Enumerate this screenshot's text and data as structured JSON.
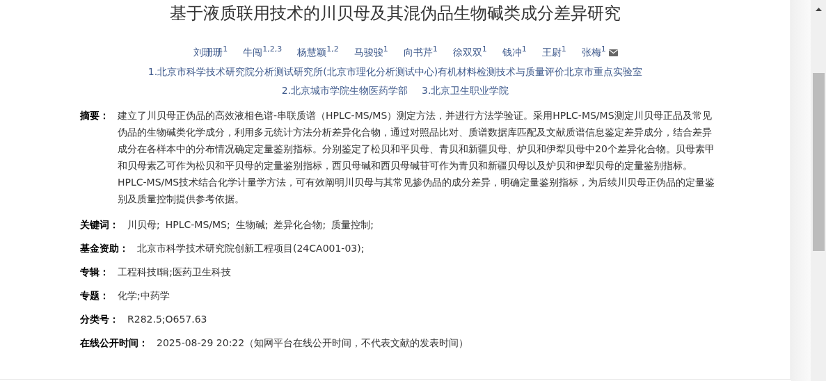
{
  "title": "基于液质联用技术的川贝母及其混伪品生物碱类成分差异研究",
  "authors": [
    {
      "name": "刘珊珊$^{1}$",
      "email": false
    },
    {
      "name": "牛闯$^{1,2,3}$",
      "email": false
    },
    {
      "name": "杨慧颖$^{1,2}$",
      "email": false
    },
    {
      "name": "马骏骏$^{1}$",
      "email": false
    },
    {
      "name": "向书芹$^{1}$",
      "email": false
    },
    {
      "name": "徐双双$^{1}$",
      "email": false
    },
    {
      "name": "钱冲$^{1}$",
      "email": false
    },
    {
      "name": "王尉$^{1}$",
      "email": false
    },
    {
      "name": "张梅$^{1}$",
      "email": true
    }
  ],
  "affiliations": [
    [
      "1.北京市科学技术研究院分析测试研究所(北京市理化分析测试中心)有机材料检测技术与质量评价北京市重点实验室"
    ],
    [
      "2.北京城市学院生物医药学部",
      "3.北京卫生职业学院"
    ]
  ],
  "abstract": {
    "label": "摘要：",
    "text": "建立了川贝母正伪品的高效液相色谱-串联质谱（HPLC-MS/MS）测定方法，并进行方法学验证。采用HPLC-MS/MS测定川贝母正品及常见伪品的生物碱类化学成分，利用多元统计方法分析差异化合物，通过对照品比对、质谱数据库匹配及文献质谱信息鉴定差异成分，结合差异成分在各样本中的分布情况确定定量鉴别指标。分别鉴定了松贝和平贝母、青贝和新疆贝母、炉贝和伊犁贝母中20个差异化合物。贝母素甲和贝母素乙可作为松贝和平贝母的定量鉴别指标，西贝母碱和西贝母碱苷可作为青贝和新疆贝母以及炉贝和伊犁贝母的定量鉴别指标。HPLC-MS/MS技术结合化学计量学方法，可有效阐明川贝母与其常见掺伪品的成分差异，明确定量鉴别指标，为后续川贝母正伪品的定量鉴别及质量控制提供参考依据。"
  },
  "fields": [
    {
      "kind": "links",
      "label": "关键词：",
      "items": [
        "川贝母;",
        "HPLC-MS/MS;",
        "生物碱;",
        "差异化合物;",
        "质量控制;"
      ]
    },
    {
      "kind": "links",
      "label": "基金资助：",
      "items": [
        "北京市科学技术研究院创新工程项目(24CA001-03);"
      ]
    },
    {
      "kind": "text",
      "label": "专辑：",
      "value": "工程科技Ⅰ辑;医药卫生科技"
    },
    {
      "kind": "text",
      "label": "专题：",
      "value": "化学;中药学"
    },
    {
      "kind": "text",
      "label": "分类号：",
      "value": "R282.5;O657.63"
    },
    {
      "kind": "text",
      "label": "在线公开时间：",
      "value": "2025-08-29 20:22（知网平台在线公开时间，不代表文献的发表时间）"
    }
  ]
}
